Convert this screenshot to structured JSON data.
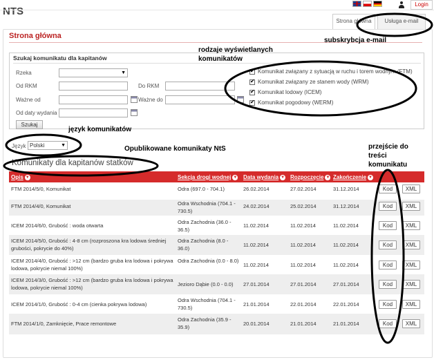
{
  "header": {
    "app_title": "NTS",
    "login_label": "Login",
    "languages": [
      "en-flag",
      "pl-flag",
      "de-flag"
    ],
    "user_icon": "user-icon"
  },
  "tabs": [
    {
      "label": "Strona główna",
      "active": true
    },
    {
      "label": "Usługa e-mail",
      "active": false
    }
  ],
  "page": {
    "title": "Strona główna"
  },
  "search": {
    "title": "Szukaj komunikatu dla kapitanów",
    "fields": {
      "rzeka_label": "Rzeka",
      "od_rkm_label": "Od RKM",
      "do_rkm_label": "Do RKM",
      "wazne_od_label": "Ważne od",
      "wazne_do_label": "Ważne do",
      "od_daty_label": "Od daty wydania"
    },
    "button_label": "Szukaj",
    "message_types": [
      {
        "label": "Komunikat związany z sytuacją w ruchu i torem wodnym (FTM)",
        "checked": true
      },
      {
        "label": "Komunikat związany ze stanem wody (WRM)",
        "checked": true
      },
      {
        "label": "Komunikat lodowy (ICEM)",
        "checked": true
      },
      {
        "label": "Komunikat pogodowy (WERM)",
        "checked": true
      }
    ]
  },
  "language": {
    "label": "Język",
    "selected": "Polski"
  },
  "table": {
    "section_title": "Komunikaty dla kapitanów statków",
    "columns": [
      "Opis",
      "Sekcja drogi wodnej",
      "Data wydania",
      "Rozpoczęcie",
      "Zakończenie"
    ],
    "kod_label": "Kod",
    "xml_label": "XML",
    "rows": [
      {
        "opis": "FTM 2014/5/0, Komunikat",
        "sekcja": "Odra (697.0 - 704.1)",
        "wydania": "26.02.2014",
        "start": "27.02.2014",
        "end": "31.12.2014"
      },
      {
        "opis": "FTM 2014/4/0, Komunikat",
        "sekcja": "Odra Wschodnia (704.1 - 730.5)",
        "wydania": "24.02.2014",
        "start": "25.02.2014",
        "end": "31.12.2014"
      },
      {
        "opis": "ICEM 2014/6/0, Grubość : woda otwarta",
        "sekcja": "Odra Zachodnia (36.0 - 36.5)",
        "wydania": "11.02.2014",
        "start": "11.02.2014",
        "end": "11.02.2014"
      },
      {
        "opis": "ICEM 2014/5/0, Grubość : 4-8 cm (rozproszona kra lodowa średniej grubości, pokrycie do 40%)",
        "sekcja": "Odra Zachodnia (8.0 - 36.0)",
        "wydania": "11.02.2014",
        "start": "11.02.2014",
        "end": "11.02.2014"
      },
      {
        "opis": "ICEM 2014/4/0, Grubość : >12 cm (bardzo gruba kra lodowa i pokrywa lodowa, pokrycie niemal 100%)",
        "sekcja": "Odra Zachodnia (0.0 - 8.0)",
        "wydania": "11.02.2014",
        "start": "11.02.2014",
        "end": "11.02.2014"
      },
      {
        "opis": "ICEM 2014/3/0, Grubość : >12 cm (bardzo gruba kra lodowa i pokrywa lodowa, pokrycie niemal 100%)",
        "sekcja": "Jezioro Dąbie (0.0 - 0.0)",
        "wydania": "27.01.2014",
        "start": "27.01.2014",
        "end": "27.01.2014"
      },
      {
        "opis": "ICEM 2014/1/0, Grubość : 0-4 cm (cienka pokrywa lodowa)",
        "sekcja": "Odra Wschodnia (704.1 - 730.5)",
        "wydania": "21.01.2014",
        "start": "22.01.2014",
        "end": "22.01.2014"
      },
      {
        "opis": "FTM 2014/1/0, Zamknięcie, Prace remontowe",
        "sekcja": "Odra Zachodnia (35.9 - 35.9)",
        "wydania": "20.01.2014",
        "start": "21.01.2014",
        "end": "21.01.2014"
      }
    ]
  },
  "annotations": {
    "subscription": "subskrybcja e-mail",
    "message_types": "rodzaje wyświetlanych komunikatów",
    "language": "język komunikatów",
    "published": "Opublikowane komunikaty NtS",
    "go_to": "przejście do treści komunikatu"
  }
}
